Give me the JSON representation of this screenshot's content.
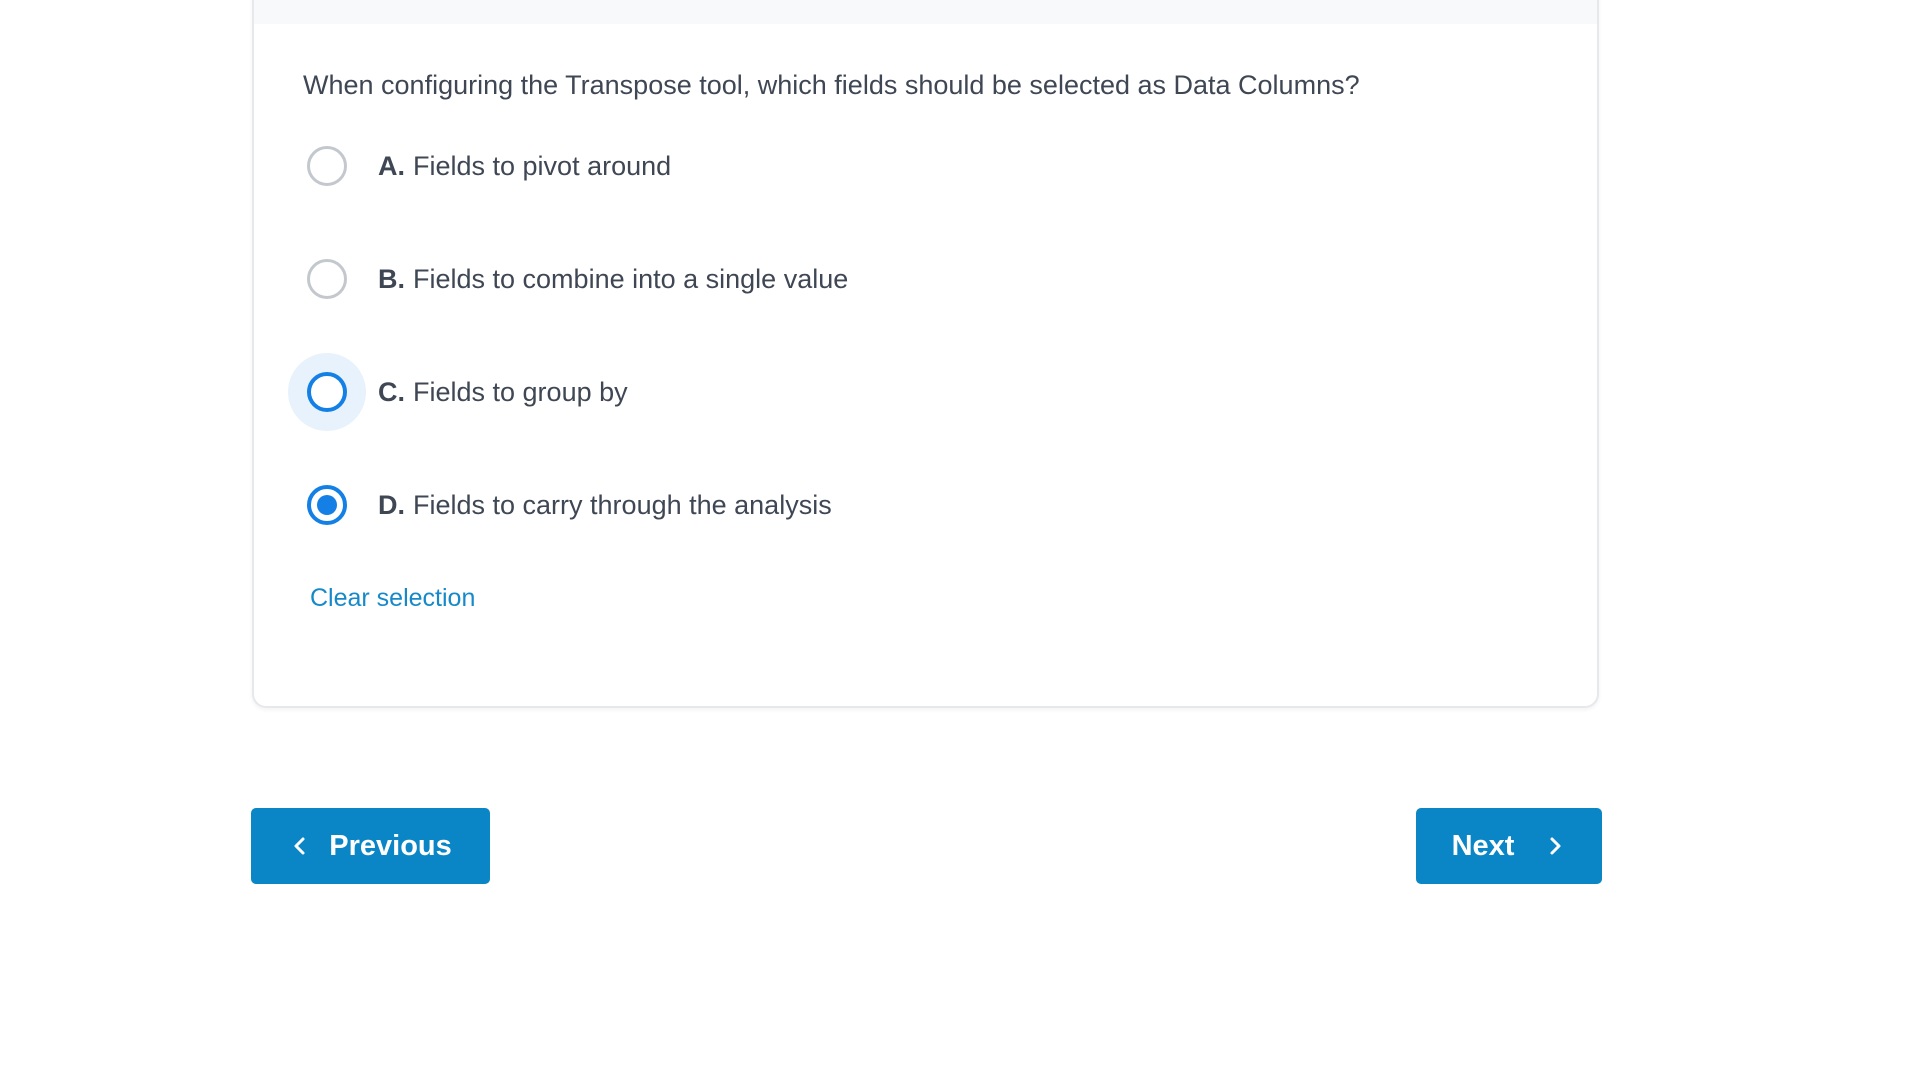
{
  "question": {
    "text": "When configuring the Transpose tool, which fields should be selected as Data Columns?"
  },
  "options": [
    {
      "letter": "A.",
      "text": "Fields to pivot around",
      "state": "unselected"
    },
    {
      "letter": "B.",
      "text": "Fields to combine into a single value",
      "state": "unselected"
    },
    {
      "letter": "C.",
      "text": "Fields to group by",
      "state": "hover"
    },
    {
      "letter": "D.",
      "text": "Fields to carry through the analysis",
      "state": "selected"
    }
  ],
  "clear_selection_label": "Clear selection",
  "navigation": {
    "previous_label": "Previous",
    "next_label": "Next"
  },
  "colors": {
    "accent": "#1480e6",
    "button": "#0a86c6",
    "link": "#1689c9",
    "text": "#3f4754"
  },
  "icons": {
    "previous": "chevron-left-icon",
    "next": "chevron-right-icon"
  }
}
